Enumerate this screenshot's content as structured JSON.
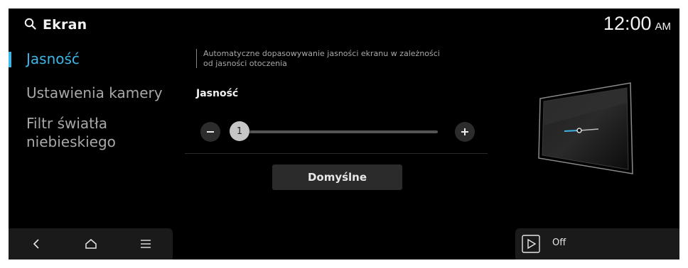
{
  "header": {
    "title": "Ekran",
    "time": "12:00",
    "ampm": "AM"
  },
  "sidebar": {
    "items": [
      {
        "label": "Jasność",
        "active": true
      },
      {
        "label": "Ustawienia kamery",
        "active": false
      },
      {
        "label_line1": "Filtr światła",
        "label_line2": "niebieskiego",
        "active": false
      }
    ]
  },
  "main": {
    "description_line1": "Automatyczne dopasowywanie jasności ekranu w zależności",
    "description_line2": "od jasności otoczenia",
    "brightness_label": "Jasność",
    "slider": {
      "value": "1",
      "min_level": 1
    },
    "default_button": "Domyślne"
  },
  "footer": {
    "status_label": "Off"
  },
  "colors": {
    "accent": "#3fb6e8",
    "background": "#000000",
    "panel": "#1a1a1a"
  },
  "icons": [
    "search-icon",
    "minus-icon",
    "plus-icon",
    "back-icon",
    "home-icon",
    "menu-icon",
    "play-icon",
    "screen-illustration"
  ]
}
